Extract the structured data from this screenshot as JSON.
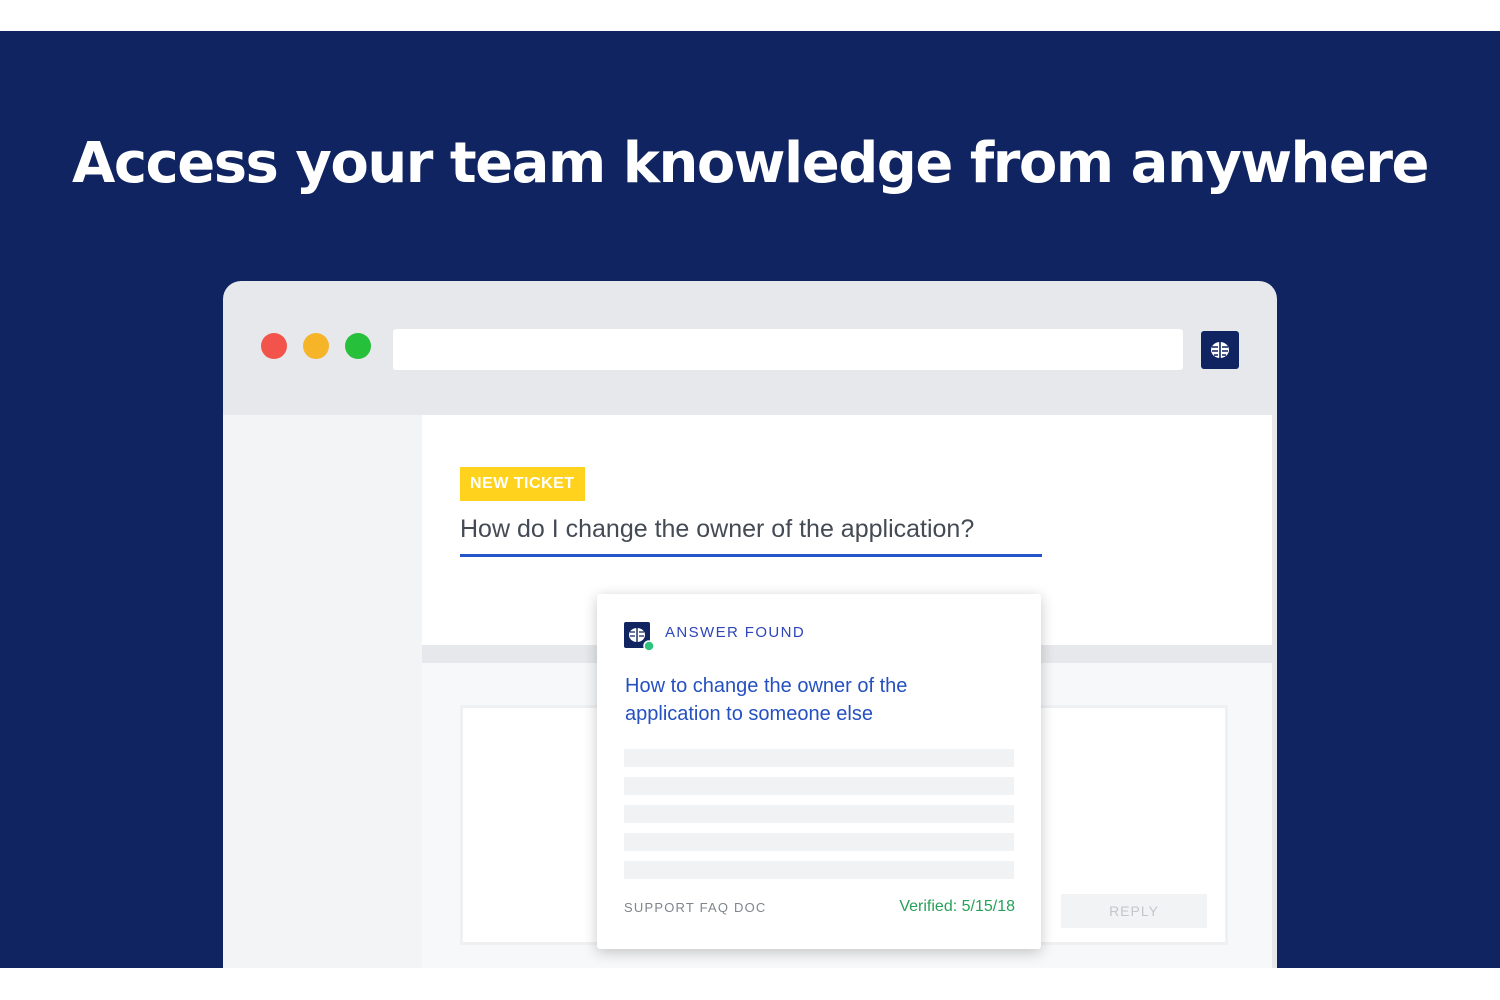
{
  "hero": {
    "headline": "Access your team knowledge from anywhere"
  },
  "browser": {
    "window_controls": [
      "close",
      "minimize",
      "maximize"
    ],
    "url_value": "",
    "extension_icon": "brain-icon"
  },
  "ticket": {
    "badge": "NEW TICKET",
    "question": "How do I change the owner of the application?"
  },
  "answer_card": {
    "icon": "card-logo-icon",
    "status": "ANSWER FOUND",
    "title": "How to change the owner of the application to someone else",
    "source": "SUPPORT FAQ DOC",
    "verified": "Verified: 5/15/18"
  },
  "reply": {
    "button_label": "REPLY"
  },
  "colors": {
    "banner_bg": "#0f2460",
    "badge_bg": "#ffd21d",
    "link_blue": "#2550c0",
    "verified_green": "#27a05a",
    "underline_blue": "#2556c8"
  }
}
